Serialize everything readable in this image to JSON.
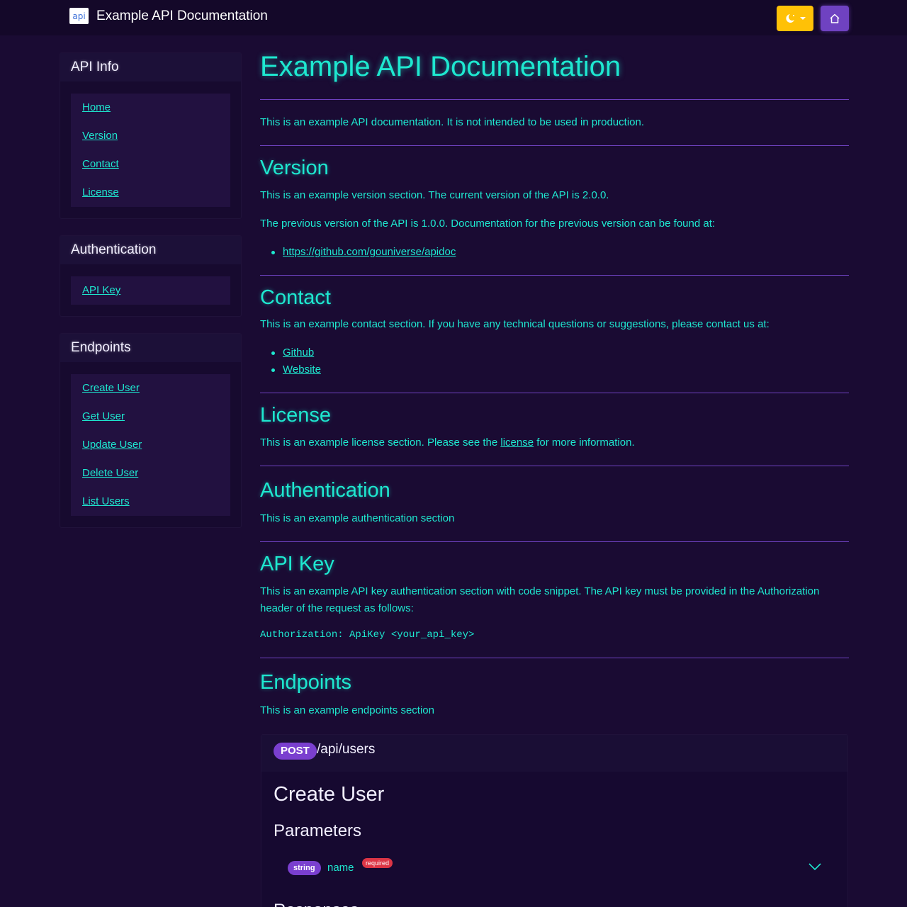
{
  "navbar": {
    "logo_text": "api",
    "title": "Example API Documentation",
    "theme_icon": "moon-stars-icon",
    "home_icon": "home-icon",
    "colors": {
      "theme_button": "#ffc107",
      "home_button": "#6f42c1"
    }
  },
  "sidebar": {
    "api_info": {
      "header": "API Info",
      "items": [
        "Home",
        "Version",
        "Contact",
        "License"
      ]
    },
    "authentication": {
      "header": "Authentication",
      "items": [
        "API Key"
      ]
    },
    "endpoints": {
      "header": "Endpoints",
      "items": [
        "Create User",
        "Get User",
        "Update User",
        "Delete User",
        "List Users"
      ]
    }
  },
  "main": {
    "title": "Example API Documentation",
    "intro": "This is an example API documentation. It is not intended to be used in production.",
    "version": {
      "heading": "Version",
      "p1": "This is an example version section. The current version of the API is 2.0.0.",
      "p2": "The previous version of the API is 1.0.0. Documentation for the previous version can be found at:",
      "link": "https://github.com/gouniverse/apidoc"
    },
    "contact": {
      "heading": "Contact",
      "p1": "This is an example contact section. If you have any technical questions or suggestions, please contact us at:",
      "links": [
        "Github",
        "Website"
      ]
    },
    "license": {
      "heading": "License",
      "before": "This is an example license section. Please see the",
      "link": "license",
      "after": "for more information."
    },
    "authentication": {
      "heading": "Authentication",
      "p1": "This is an example authentication section"
    },
    "api_key": {
      "heading": "API Key",
      "p1_line1": "This is an example API key authentication section with code snippet. The API key must be provided in the Authorization",
      "p1_line2": "header of the request as follows:",
      "code": "Authorization: ApiKey <your_api_key>"
    },
    "endpoints": {
      "heading": "Endpoints",
      "p1": "This is an example endpoints section"
    },
    "endpoint_card": {
      "method": "POST",
      "path": "/api/users",
      "title": "Create User",
      "parameters_heading": "Parameters",
      "param_type": "string",
      "param_name": "name",
      "param_required": "required",
      "next_heading": "Responses"
    }
  }
}
